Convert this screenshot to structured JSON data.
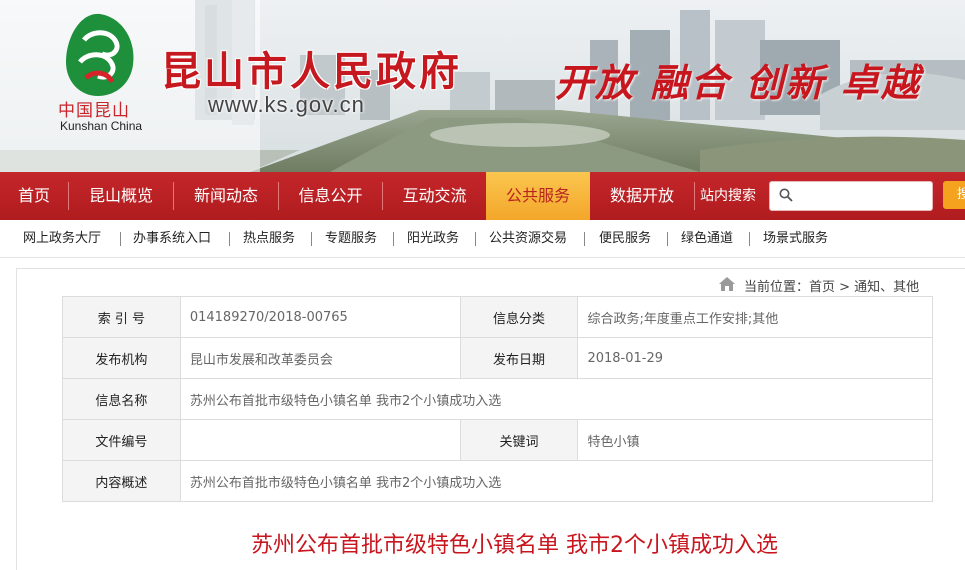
{
  "banner": {
    "logo_cn": "中国昆山",
    "logo_en": "Kunshan China",
    "title": "昆山市人民政府",
    "url": "www.ks.gov.cn",
    "slogan": "开放 融合 创新 卓越"
  },
  "nav": {
    "items": [
      {
        "label": "首页"
      },
      {
        "label": "昆山概览"
      },
      {
        "label": "新闻动态"
      },
      {
        "label": "信息公开"
      },
      {
        "label": "互动交流"
      },
      {
        "label": "公共服务"
      },
      {
        "label": "数据开放"
      }
    ],
    "active_index": 5,
    "search_label": "站内搜索",
    "search_placeholder": "",
    "search_button": "搜"
  },
  "subnav": {
    "items": [
      {
        "label": "网上政务大厅"
      },
      {
        "label": "办事系统入口"
      },
      {
        "label": "热点服务"
      },
      {
        "label": "专题服务"
      },
      {
        "label": "阳光政务"
      },
      {
        "label": "公共资源交易"
      },
      {
        "label": "便民服务"
      },
      {
        "label": "绿色通道"
      },
      {
        "label": "场景式服务"
      }
    ]
  },
  "breadcrumb": {
    "text": "当前位置：首页 > 通知、其他"
  },
  "info": {
    "index_label": "索 引 号",
    "index_value": "014189270/2018-00765",
    "category_label": "信息分类",
    "category_value": "综合政务;年度重点工作安排;其他",
    "publisher_label": "发布机构",
    "publisher_value": "昆山市发展和改革委员会",
    "date_label": "发布日期",
    "date_value": "2018-01-29",
    "name_label": "信息名称",
    "name_value": "苏州公布首批市级特色小镇名单 我市2个小镇成功入选",
    "docno_label": "文件编号",
    "docno_value": "",
    "keyword_label": "关键词",
    "keyword_value": "特色小镇",
    "summary_label": "内容概述",
    "summary_value": "苏州公布首批市级特色小镇名单 我市2个小镇成功入选"
  },
  "article": {
    "title": "苏州公布首批市级特色小镇名单 我市2个小镇成功入选"
  },
  "colors": {
    "brand_red": "#c4262a",
    "active_orange": "#f3a62a",
    "title_red": "#c8161e"
  },
  "icons": [
    "kunshan-logo-icon",
    "search-icon",
    "home-icon"
  ]
}
